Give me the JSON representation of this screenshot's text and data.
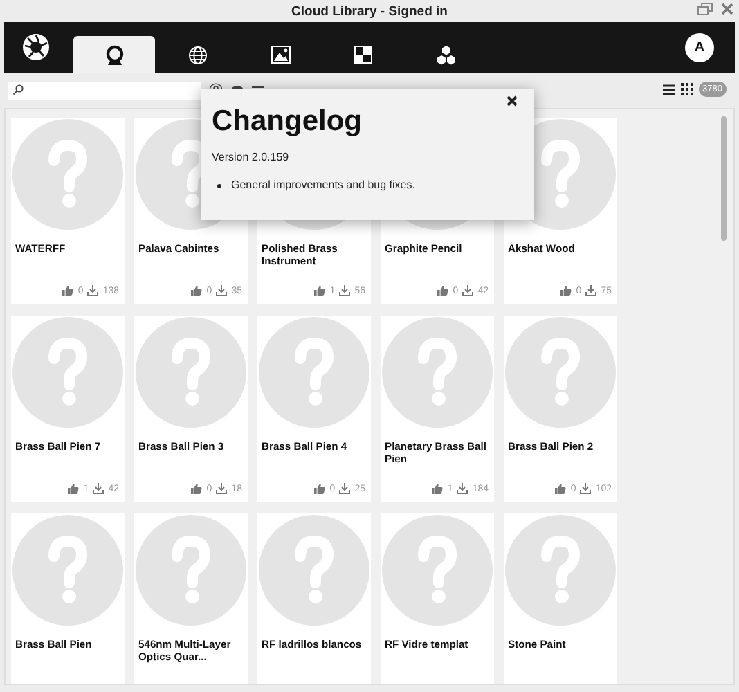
{
  "window": {
    "title": "Cloud Library - Signed in"
  },
  "tabs": [
    {
      "kind": "search",
      "selected": true
    },
    {
      "kind": "globe",
      "selected": false
    },
    {
      "kind": "image",
      "selected": false
    },
    {
      "kind": "checker",
      "selected": false
    },
    {
      "kind": "cubes",
      "selected": false
    }
  ],
  "avatar": {
    "initial": "A"
  },
  "toolbar": {
    "result_count": "3780"
  },
  "items": [
    {
      "title": "WATERFF",
      "likes": "0",
      "downloads": "138"
    },
    {
      "title": "Palava Cabintes",
      "likes": "0",
      "downloads": "35"
    },
    {
      "title": "Polished Brass Instrument",
      "likes": "1",
      "downloads": "56"
    },
    {
      "title": "Graphite Pencil",
      "likes": "0",
      "downloads": "42"
    },
    {
      "title": "Akshat Wood",
      "likes": "0",
      "downloads": "75"
    },
    {
      "title": "Brass Ball Pien 7",
      "likes": "1",
      "downloads": "42"
    },
    {
      "title": "Brass Ball Pien 3",
      "likes": "0",
      "downloads": "18"
    },
    {
      "title": "Brass Ball Pien 4",
      "likes": "0",
      "downloads": "25"
    },
    {
      "title": "Planetary Brass Ball Pien",
      "likes": "1",
      "downloads": "184"
    },
    {
      "title": "Brass Ball Pien 2",
      "likes": "0",
      "downloads": "102"
    },
    {
      "title": "Brass Ball Pien"
    },
    {
      "title": "546nm Multi-Layer Optics Quar..."
    },
    {
      "title": "RF ladrillos blancos"
    },
    {
      "title": "RF Vidre templat"
    },
    {
      "title": "Stone Paint"
    }
  ],
  "dialog": {
    "title": "Changelog",
    "version": "Version 2.0.159",
    "notes": [
      "General improvements and bug fixes."
    ]
  }
}
